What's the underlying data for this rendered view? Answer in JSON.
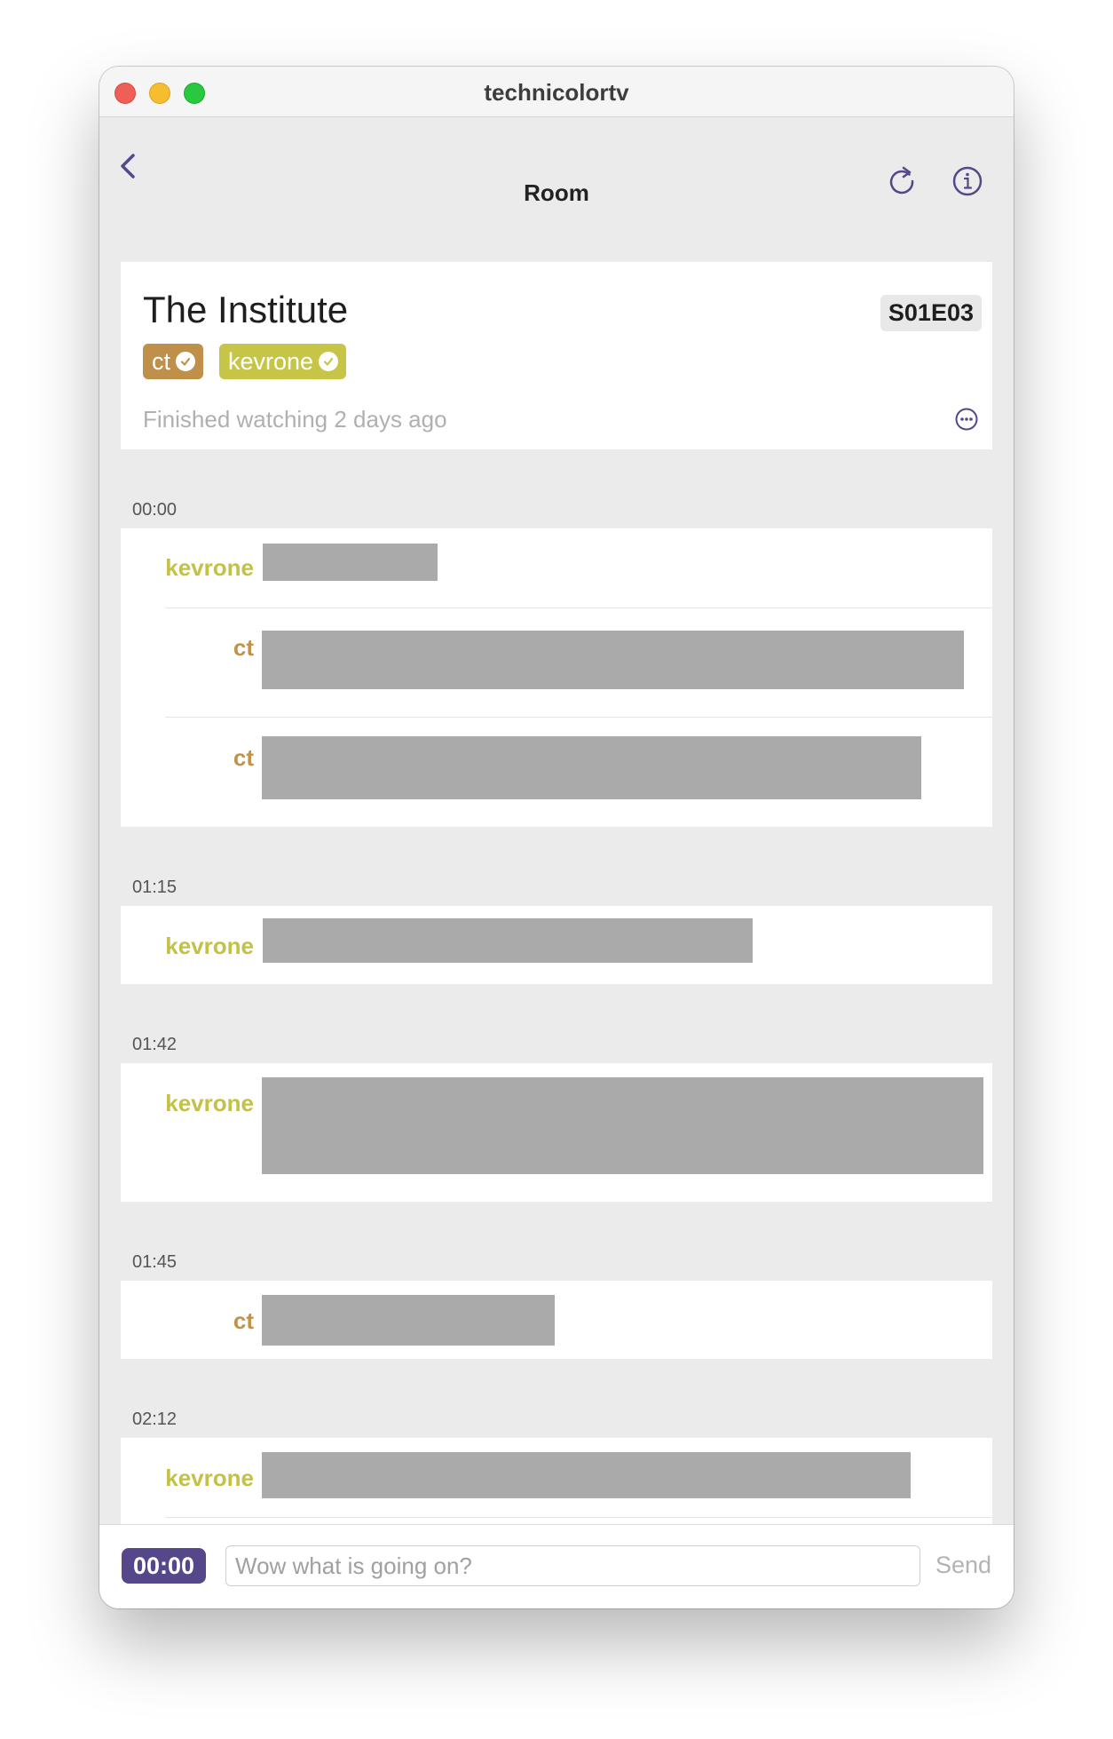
{
  "window": {
    "title": "technicolortv"
  },
  "nav": {
    "title": "Room",
    "back_icon": "chevron-left-icon",
    "refresh_icon": "refresh-icon",
    "info_icon": "info-icon"
  },
  "show": {
    "title": "The Institute",
    "episode": "S01E03",
    "status": "Finished watching 2 days ago",
    "participants": [
      {
        "name": "ct",
        "color": "#bf9049",
        "icon": "check-circle-icon"
      },
      {
        "name": "kevrone",
        "color": "#c7c548",
        "icon": "check-circle-icon"
      }
    ]
  },
  "colors": {
    "accent": "#56468a",
    "ct": "#c39249",
    "kevrone": "#c3c146",
    "redaction": "#aaaaaa"
  },
  "groups": [
    {
      "time": "00:00",
      "messages": [
        {
          "user": "kevrone"
        },
        {
          "user": "ct"
        },
        {
          "user": "ct"
        }
      ]
    },
    {
      "time": "01:15",
      "messages": [
        {
          "user": "kevrone"
        }
      ]
    },
    {
      "time": "01:42",
      "messages": [
        {
          "user": "kevrone"
        }
      ]
    },
    {
      "time": "01:45",
      "messages": [
        {
          "user": "ct"
        }
      ]
    },
    {
      "time": "02:12",
      "messages": [
        {
          "user": "kevrone"
        }
      ]
    }
  ],
  "composer": {
    "time": "00:00",
    "placeholder": "Wow what is going on?",
    "value": "",
    "send_label": "Send"
  }
}
